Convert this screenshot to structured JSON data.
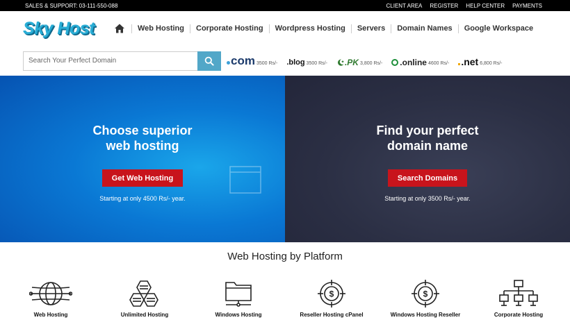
{
  "topbar": {
    "support": "SALES & SUPPORT: 03-111-550-088",
    "links": [
      "CLIENT AREA",
      "REGISTER",
      "HELP CENTER",
      "PAYMENTS"
    ]
  },
  "logo": "Sky Host",
  "nav": [
    "Web Hosting",
    "Corporate Hosting",
    "Wordpress Hosting",
    "Servers",
    "Domain Names",
    "Google Workspace"
  ],
  "search": {
    "placeholder": "Search Your Perfect Domain"
  },
  "tlds": [
    {
      "name": "com",
      "price": "3500 Rs/-"
    },
    {
      "name": ".blog",
      "price": "3500 Rs/-"
    },
    {
      "name": ".PK",
      "price": "3,800 Rs/-"
    },
    {
      "name": ".online",
      "price": "4600 Rs/-"
    },
    {
      "name": ".net",
      "price": "6,800 Rs/-"
    }
  ],
  "hero": {
    "left": {
      "title_line1": "Choose superior",
      "title_line2": "web hosting",
      "button": "Get Web Hosting",
      "note": "Starting at only 4500 Rs/- year."
    },
    "right": {
      "title_line1": "Find your perfect",
      "title_line2": "domain name",
      "button": "Search Domains",
      "note": "Starting at only 3500 Rs/- year."
    }
  },
  "platforms": {
    "title": "Web Hosting by Platform",
    "items": [
      "Web Hosting",
      "Unlimited Hosting",
      "Windows Hosting",
      "Reseller Hosting cPanel",
      "Windows Hosting Reseller",
      "Corporate Hosting"
    ]
  },
  "colors": {
    "accent": "#c8141c",
    "brand": "#2aaed6",
    "search_button": "#52a7c8"
  }
}
